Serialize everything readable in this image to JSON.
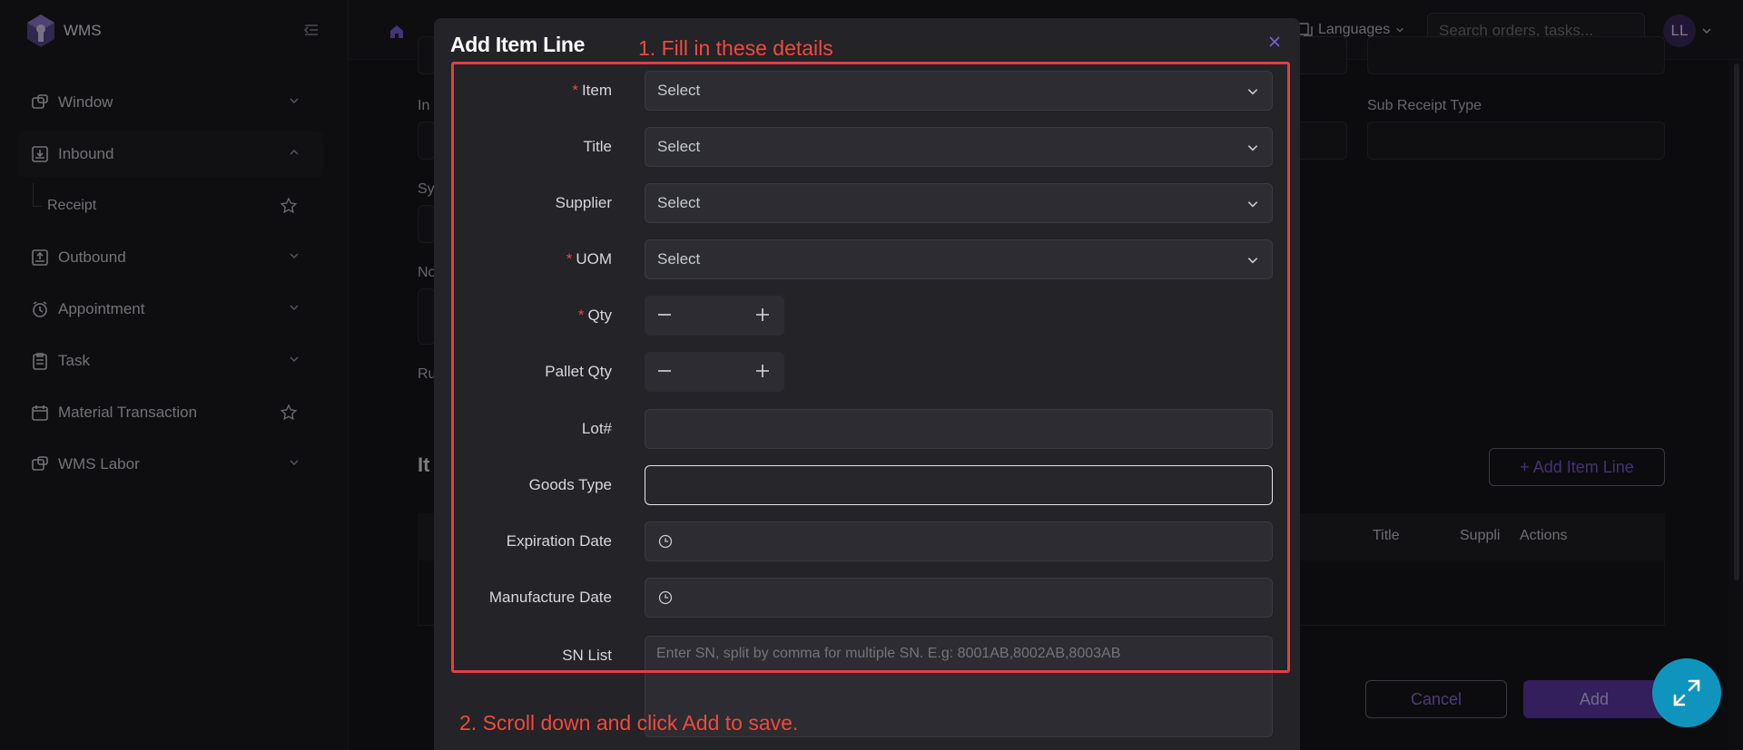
{
  "sidebar": {
    "brand": "WMS",
    "items": [
      {
        "label": "Window",
        "icon": "window-icon"
      },
      {
        "label": "Inbound",
        "icon": "inbound-icon"
      },
      {
        "label": "Receipt"
      },
      {
        "label": "Outbound",
        "icon": "outbound-icon"
      },
      {
        "label": "Appointment",
        "icon": "alarm-icon"
      },
      {
        "label": "Task",
        "icon": "clipboard-icon"
      },
      {
        "label": "Material Transaction",
        "icon": "calendar-icon"
      },
      {
        "label": "WMS Labor",
        "icon": "labor-icon"
      }
    ]
  },
  "topbar": {
    "languages": "Languages",
    "search_placeholder": "Search orders, tasks...",
    "avatar": "LL"
  },
  "background": {
    "sub_receipt_type": "Sub Receipt Type",
    "add_item_line": "+ Add Item Line",
    "col_title": "Title",
    "col_supplier": "Suppli",
    "col_actions": "Actions",
    "frag_in": "In",
    "frag_sy": "Sy",
    "frag_no": "No",
    "frag_ru": "Ru",
    "frag_it": "It",
    "cancel": "Cancel",
    "add": "Add"
  },
  "modal": {
    "title": "Add Item Line",
    "fields": {
      "item": {
        "label": "Item",
        "value": "Select"
      },
      "title": {
        "label": "Title",
        "value": "Select"
      },
      "supplier": {
        "label": "Supplier",
        "value": "Select"
      },
      "uom": {
        "label": "UOM",
        "value": "Select"
      },
      "qty": {
        "label": "Qty"
      },
      "pallet_qty": {
        "label": "Pallet Qty"
      },
      "lot": {
        "label": "Lot#"
      },
      "goods_type": {
        "label": "Goods Type"
      },
      "expiration_date": {
        "label": "Expiration Date"
      },
      "manufacture_date": {
        "label": "Manufacture Date"
      },
      "sn_list": {
        "label": "SN List",
        "placeholder": "Enter SN, split by comma for multiple SN. E.g: 8001AB,8002AB,8003AB"
      }
    },
    "required_mark": "*"
  },
  "annotations": {
    "step1": "1. Fill in these details",
    "step2": "2. Scroll down and click Add to save."
  },
  "colors": {
    "accent": "#7d5fd9",
    "annotation": "#e2403d",
    "fab": "#0f95bd"
  }
}
